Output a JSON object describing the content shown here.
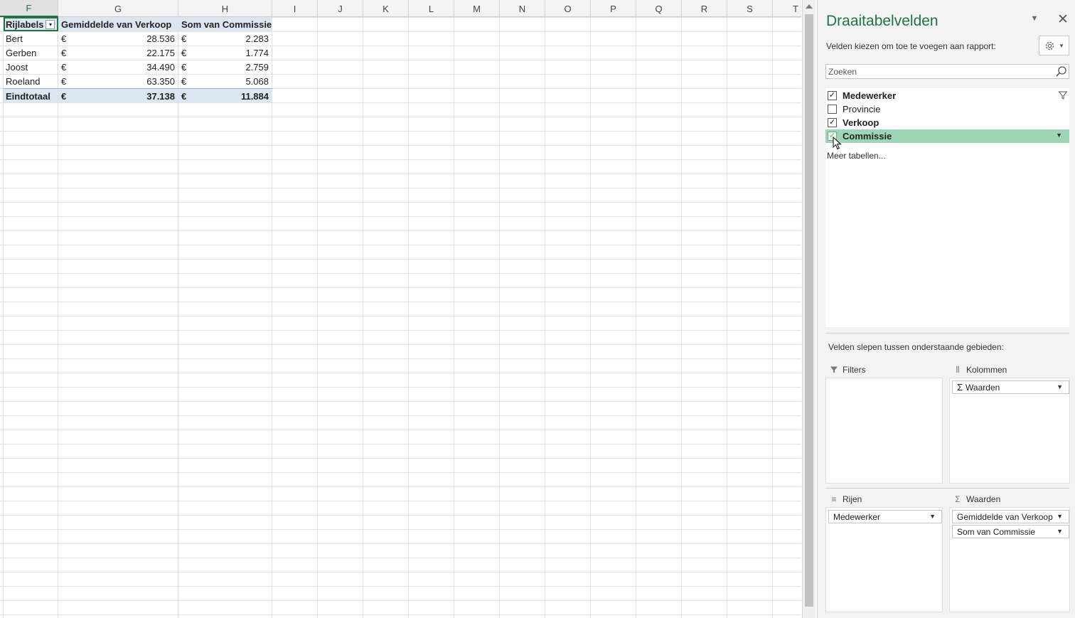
{
  "columns": [
    "F",
    "G",
    "H",
    "I",
    "J",
    "K",
    "L",
    "M",
    "N",
    "O",
    "P",
    "Q",
    "R",
    "S",
    "T"
  ],
  "selected_column": "F",
  "pivot": {
    "header": {
      "row_labels": "Rijlabels",
      "col_g": "Gemiddelde van Verkoop",
      "col_h": "Som van Commissie"
    },
    "currency": "€",
    "rows": [
      {
        "name": "Bert",
        "avg_sales": "28.536",
        "sum_commission": "2.283"
      },
      {
        "name": "Gerben",
        "avg_sales": "22.175",
        "sum_commission": "1.774"
      },
      {
        "name": "Joost",
        "avg_sales": "34.490",
        "sum_commission": "2.759"
      },
      {
        "name": "Roeland",
        "avg_sales": "63.350",
        "sum_commission": "5.068"
      }
    ],
    "total": {
      "name": "Eindtotaal",
      "avg_sales": "37.138",
      "sum_commission": "11.884"
    }
  },
  "pane": {
    "title": "Draaitabelvelden",
    "subtitle": "Velden kiezen om toe te voegen aan rapport:",
    "search_placeholder": "Zoeken",
    "fields": [
      {
        "label": "Medewerker",
        "checked": true,
        "bold": true
      },
      {
        "label": "Provincie",
        "checked": false,
        "bold": false
      },
      {
        "label": "Verkoop",
        "checked": true,
        "bold": true
      },
      {
        "label": "Commissie",
        "checked": true,
        "bold": true
      }
    ],
    "more_tables": "Meer tabellen...",
    "drag_label": "Velden slepen tussen onderstaande gebieden:",
    "areas": {
      "filters": {
        "label": "Filters"
      },
      "columns": {
        "label": "Kolommen",
        "items": [
          "Waarden"
        ]
      },
      "rows": {
        "label": "Rijen",
        "items": [
          "Medewerker"
        ]
      },
      "values": {
        "label": "Waarden",
        "items": [
          "Gemiddelde van Verkoop",
          "Som van Commissie"
        ]
      }
    },
    "colors": {
      "accent": "#217346",
      "highlight": "#9fd5b7",
      "pivot_header": "#dce6f1"
    }
  }
}
